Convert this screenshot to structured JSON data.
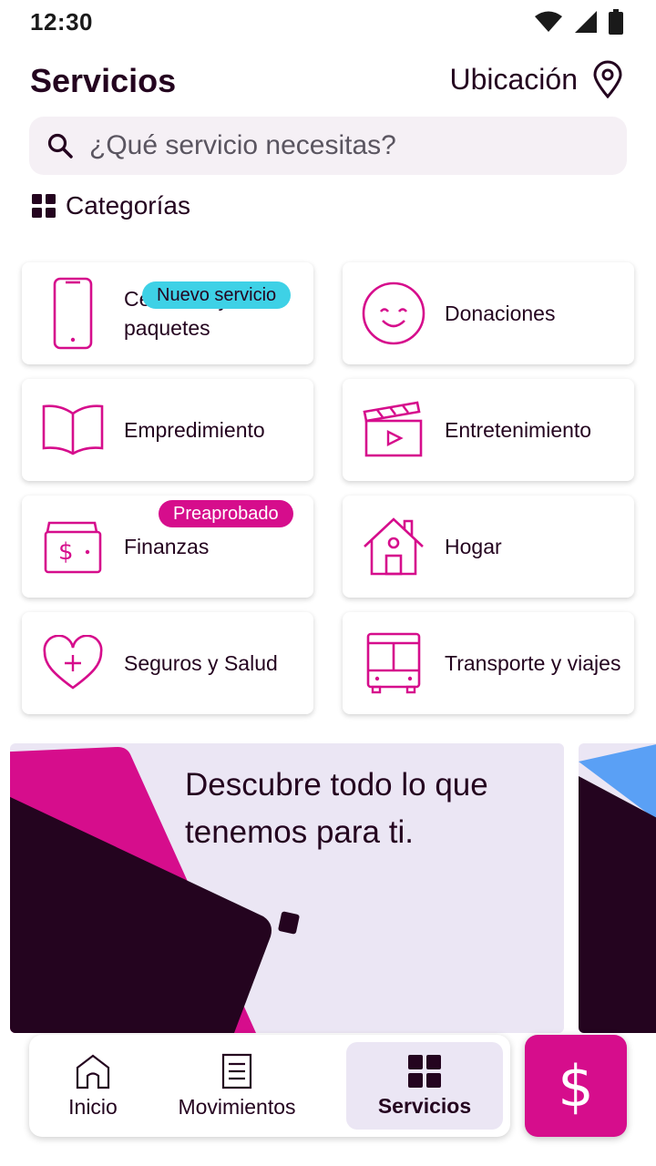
{
  "status_bar": {
    "time": "12:30"
  },
  "header": {
    "title": "Servicios",
    "location_label": "Ubicación"
  },
  "search": {
    "placeholder": "¿Qué servicio necesitas?"
  },
  "categories": {
    "heading": "Categorías",
    "items": [
      {
        "label": "Celulares y paquetes",
        "badge": "Nuevo servicio",
        "icon": "phone-icon"
      },
      {
        "label": "Donaciones",
        "icon": "smile-icon"
      },
      {
        "label": "Empredimiento",
        "icon": "book-icon"
      },
      {
        "label": "Entretenimiento",
        "icon": "clapperboard-icon"
      },
      {
        "label": "Finanzas",
        "badge": "Preaprobado",
        "icon": "wallet-icon"
      },
      {
        "label": "Hogar",
        "icon": "house-icon"
      },
      {
        "label": "Seguros y Salud",
        "icon": "heart-plus-icon"
      },
      {
        "label": "Transporte y viajes",
        "icon": "bus-icon"
      }
    ]
  },
  "banner": {
    "text": "Descubre todo lo que tenemos para ti."
  },
  "bottom_nav": {
    "items": [
      {
        "label": "Inicio",
        "icon": "home-icon"
      },
      {
        "label": "Movimientos",
        "icon": "receipt-icon"
      },
      {
        "label": "Servicios",
        "icon": "grid-icon",
        "active": true
      }
    ]
  },
  "fab": {
    "symbol": "$",
    "icon": "dollar-icon"
  },
  "colors": {
    "brand_magenta": "#d60d8c",
    "dark_plum": "#24041f",
    "banner_bg": "#ebe6f4",
    "badge_cyan": "#3ed1e6",
    "accent_blue": "#5aa0f5"
  }
}
